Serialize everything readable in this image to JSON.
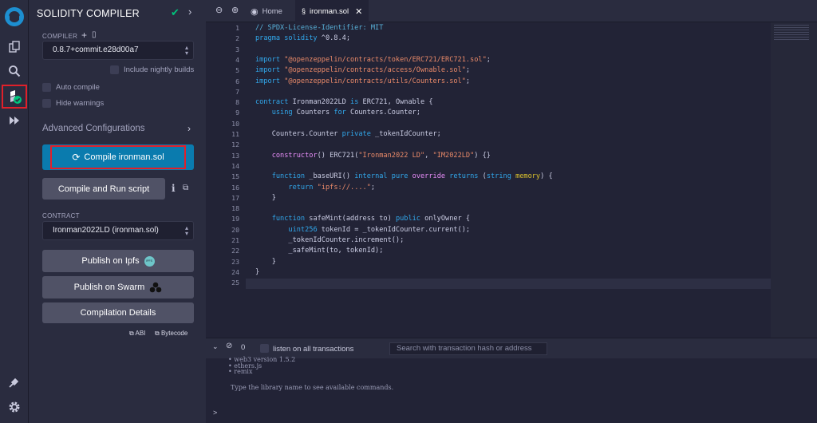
{
  "sidebar_rail": {
    "items": [
      "remix-logo-icon",
      "file-explorer-icon",
      "search-icon",
      "solidity-compiler-icon",
      "deploy-run-icon",
      "plugin-manager-icon",
      "settings-icon"
    ]
  },
  "panel": {
    "title": "SOLIDITY COMPILER",
    "compiler_label": "COMPILER",
    "compiler_version": "0.8.7+commit.e28d00a7",
    "include_nightly": "Include nightly builds",
    "auto_compile": "Auto compile",
    "hide_warnings": "Hide warnings",
    "advanced": "Advanced Configurations",
    "compile_button": "Compile ironman.sol",
    "run_script_button": "Compile and Run script",
    "contract_label": "CONTRACT",
    "contract_value": "Ironman2022LD (ironman.sol)",
    "publish_ipfs": "Publish on Ipfs",
    "ipfs_badge": "IPFS",
    "publish_swarm": "Publish on Swarm",
    "compilation_details": "Compilation Details",
    "abi": "ABI",
    "bytecode": "Bytecode"
  },
  "editor": {
    "tabs": [
      {
        "label": "Home"
      },
      {
        "label": "ironman.sol"
      }
    ],
    "lines": [
      [
        {
          "t": "// SPDX-License-Identifier: MIT",
          "c": "comment"
        }
      ],
      [
        {
          "t": "pragma solidity",
          "c": "kw"
        },
        {
          "t": " ^0.8.4;",
          "c": "plain"
        }
      ],
      [],
      [
        {
          "t": "import",
          "c": "kw"
        },
        {
          "t": " ",
          "c": "plain"
        },
        {
          "t": "\"@openzeppelin/contracts/token/ERC721/ERC721.sol\"",
          "c": "str"
        },
        {
          "t": ";",
          "c": "plain"
        }
      ],
      [
        {
          "t": "import",
          "c": "kw"
        },
        {
          "t": " ",
          "c": "plain"
        },
        {
          "t": "\"@openzeppelin/contracts/access/Ownable.sol\"",
          "c": "str"
        },
        {
          "t": ";",
          "c": "plain"
        }
      ],
      [
        {
          "t": "import",
          "c": "kw"
        },
        {
          "t": " ",
          "c": "plain"
        },
        {
          "t": "\"@openzeppelin/contracts/utils/Counters.sol\"",
          "c": "str"
        },
        {
          "t": ";",
          "c": "plain"
        }
      ],
      [],
      [
        {
          "t": "contract",
          "c": "kw"
        },
        {
          "t": " Ironman2022LD ",
          "c": "plain"
        },
        {
          "t": "is",
          "c": "kw"
        },
        {
          "t": " ERC721, Ownable {",
          "c": "plain"
        }
      ],
      [
        {
          "t": "    ",
          "c": "plain"
        },
        {
          "t": "using",
          "c": "kw"
        },
        {
          "t": " Counters ",
          "c": "plain"
        },
        {
          "t": "for",
          "c": "kw"
        },
        {
          "t": " Counters.Counter;",
          "c": "plain"
        }
      ],
      [],
      [
        {
          "t": "    Counters.Counter ",
          "c": "plain"
        },
        {
          "t": "private",
          "c": "kw"
        },
        {
          "t": " _tokenIdCounter;",
          "c": "plain"
        }
      ],
      [],
      [
        {
          "t": "    ",
          "c": "plain"
        },
        {
          "t": "constructor",
          "c": "fn"
        },
        {
          "t": "() ERC721(",
          "c": "plain"
        },
        {
          "t": "\"Ironman2022 LD\"",
          "c": "str"
        },
        {
          "t": ", ",
          "c": "plain"
        },
        {
          "t": "\"IM2022LD\"",
          "c": "str"
        },
        {
          "t": ") {}",
          "c": "plain"
        }
      ],
      [],
      [
        {
          "t": "    ",
          "c": "plain"
        },
        {
          "t": "function",
          "c": "kw"
        },
        {
          "t": " _baseURI() ",
          "c": "plain"
        },
        {
          "t": "internal pure",
          "c": "kw"
        },
        {
          "t": " ",
          "c": "plain"
        },
        {
          "t": "override",
          "c": "fn"
        },
        {
          "t": " ",
          "c": "plain"
        },
        {
          "t": "returns",
          "c": "kw"
        },
        {
          "t": " (",
          "c": "plain"
        },
        {
          "t": "string",
          "c": "kw"
        },
        {
          "t": " ",
          "c": "plain"
        },
        {
          "t": "memory",
          "c": "mem"
        },
        {
          "t": ") {",
          "c": "plain"
        }
      ],
      [
        {
          "t": "        ",
          "c": "plain"
        },
        {
          "t": "return",
          "c": "kw"
        },
        {
          "t": " ",
          "c": "plain"
        },
        {
          "t": "\"ipfs://....\"",
          "c": "str"
        },
        {
          "t": ";",
          "c": "plain"
        }
      ],
      [
        {
          "t": "    }",
          "c": "plain"
        }
      ],
      [],
      [
        {
          "t": "    ",
          "c": "plain"
        },
        {
          "t": "function",
          "c": "kw"
        },
        {
          "t": " safeMint(address to) ",
          "c": "plain"
        },
        {
          "t": "public",
          "c": "kw"
        },
        {
          "t": " onlyOwner {",
          "c": "plain"
        }
      ],
      [
        {
          "t": "        ",
          "c": "plain"
        },
        {
          "t": "uint256",
          "c": "kw"
        },
        {
          "t": " tokenId = _tokenIdCounter.current();",
          "c": "plain"
        }
      ],
      [
        {
          "t": "        _tokenIdCounter.increment();",
          "c": "plain"
        }
      ],
      [
        {
          "t": "        _safeMint(to, tokenId);",
          "c": "plain"
        }
      ],
      [
        {
          "t": "    }",
          "c": "plain"
        }
      ],
      [
        {
          "t": "}",
          "c": "plain"
        }
      ],
      []
    ],
    "line_numbers": [
      "1",
      "2",
      "3",
      "4",
      "5",
      "6",
      "7",
      "8",
      "9",
      "10",
      "11",
      "12",
      "13",
      "14",
      "15",
      "16",
      "17",
      "18",
      "19",
      "20",
      "21",
      "22",
      "23",
      "24",
      "25"
    ]
  },
  "terminal": {
    "count": "0",
    "listen_label": "listen on all transactions",
    "search_placeholder": "Search with transaction hash or address",
    "lines": [
      "• web3 version 1.5.2",
      "• ethers.js",
      "• remix"
    ],
    "hint": "Type the library name to see available commands.",
    "prompt": ">"
  },
  "colors": {
    "comment": "#58b0d8",
    "kw": "#31a8ec",
    "str": "#ea8a69",
    "fn": "#e98efa",
    "mem": "#ddc42c",
    "plain": "#cbcde4",
    "accent": "#0a7bae",
    "highlight": "#e0202a"
  }
}
